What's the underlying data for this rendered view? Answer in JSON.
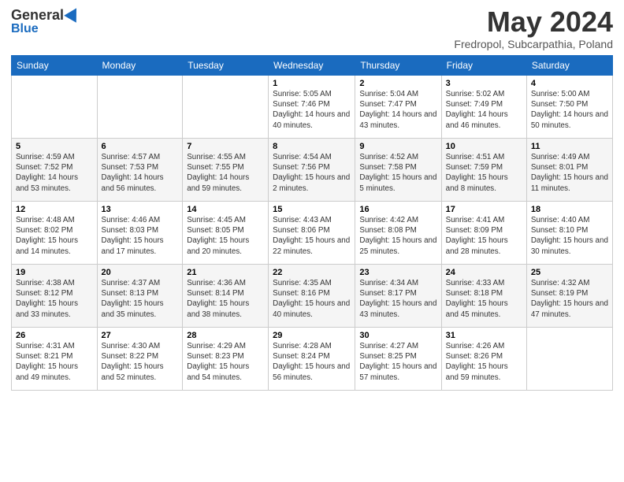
{
  "logo": {
    "general": "General",
    "blue": "Blue"
  },
  "header": {
    "month": "May 2024",
    "location": "Fredropol, Subcarpathia, Poland"
  },
  "weekdays": [
    "Sunday",
    "Monday",
    "Tuesday",
    "Wednesday",
    "Thursday",
    "Friday",
    "Saturday"
  ],
  "weeks": [
    [
      null,
      null,
      null,
      {
        "day": 1,
        "sunrise": "5:05 AM",
        "sunset": "7:46 PM",
        "daylight": "14 hours and 40 minutes."
      },
      {
        "day": 2,
        "sunrise": "5:04 AM",
        "sunset": "7:47 PM",
        "daylight": "14 hours and 43 minutes."
      },
      {
        "day": 3,
        "sunrise": "5:02 AM",
        "sunset": "7:49 PM",
        "daylight": "14 hours and 46 minutes."
      },
      {
        "day": 4,
        "sunrise": "5:00 AM",
        "sunset": "7:50 PM",
        "daylight": "14 hours and 50 minutes."
      }
    ],
    [
      {
        "day": 5,
        "sunrise": "4:59 AM",
        "sunset": "7:52 PM",
        "daylight": "14 hours and 53 minutes."
      },
      {
        "day": 6,
        "sunrise": "4:57 AM",
        "sunset": "7:53 PM",
        "daylight": "14 hours and 56 minutes."
      },
      {
        "day": 7,
        "sunrise": "4:55 AM",
        "sunset": "7:55 PM",
        "daylight": "14 hours and 59 minutes."
      },
      {
        "day": 8,
        "sunrise": "4:54 AM",
        "sunset": "7:56 PM",
        "daylight": "15 hours and 2 minutes."
      },
      {
        "day": 9,
        "sunrise": "4:52 AM",
        "sunset": "7:58 PM",
        "daylight": "15 hours and 5 minutes."
      },
      {
        "day": 10,
        "sunrise": "4:51 AM",
        "sunset": "7:59 PM",
        "daylight": "15 hours and 8 minutes."
      },
      {
        "day": 11,
        "sunrise": "4:49 AM",
        "sunset": "8:01 PM",
        "daylight": "15 hours and 11 minutes."
      }
    ],
    [
      {
        "day": 12,
        "sunrise": "4:48 AM",
        "sunset": "8:02 PM",
        "daylight": "15 hours and 14 minutes."
      },
      {
        "day": 13,
        "sunrise": "4:46 AM",
        "sunset": "8:03 PM",
        "daylight": "15 hours and 17 minutes."
      },
      {
        "day": 14,
        "sunrise": "4:45 AM",
        "sunset": "8:05 PM",
        "daylight": "15 hours and 20 minutes."
      },
      {
        "day": 15,
        "sunrise": "4:43 AM",
        "sunset": "8:06 PM",
        "daylight": "15 hours and 22 minutes."
      },
      {
        "day": 16,
        "sunrise": "4:42 AM",
        "sunset": "8:08 PM",
        "daylight": "15 hours and 25 minutes."
      },
      {
        "day": 17,
        "sunrise": "4:41 AM",
        "sunset": "8:09 PM",
        "daylight": "15 hours and 28 minutes."
      },
      {
        "day": 18,
        "sunrise": "4:40 AM",
        "sunset": "8:10 PM",
        "daylight": "15 hours and 30 minutes."
      }
    ],
    [
      {
        "day": 19,
        "sunrise": "4:38 AM",
        "sunset": "8:12 PM",
        "daylight": "15 hours and 33 minutes."
      },
      {
        "day": 20,
        "sunrise": "4:37 AM",
        "sunset": "8:13 PM",
        "daylight": "15 hours and 35 minutes."
      },
      {
        "day": 21,
        "sunrise": "4:36 AM",
        "sunset": "8:14 PM",
        "daylight": "15 hours and 38 minutes."
      },
      {
        "day": 22,
        "sunrise": "4:35 AM",
        "sunset": "8:16 PM",
        "daylight": "15 hours and 40 minutes."
      },
      {
        "day": 23,
        "sunrise": "4:34 AM",
        "sunset": "8:17 PM",
        "daylight": "15 hours and 43 minutes."
      },
      {
        "day": 24,
        "sunrise": "4:33 AM",
        "sunset": "8:18 PM",
        "daylight": "15 hours and 45 minutes."
      },
      {
        "day": 25,
        "sunrise": "4:32 AM",
        "sunset": "8:19 PM",
        "daylight": "15 hours and 47 minutes."
      }
    ],
    [
      {
        "day": 26,
        "sunrise": "4:31 AM",
        "sunset": "8:21 PM",
        "daylight": "15 hours and 49 minutes."
      },
      {
        "day": 27,
        "sunrise": "4:30 AM",
        "sunset": "8:22 PM",
        "daylight": "15 hours and 52 minutes."
      },
      {
        "day": 28,
        "sunrise": "4:29 AM",
        "sunset": "8:23 PM",
        "daylight": "15 hours and 54 minutes."
      },
      {
        "day": 29,
        "sunrise": "4:28 AM",
        "sunset": "8:24 PM",
        "daylight": "15 hours and 56 minutes."
      },
      {
        "day": 30,
        "sunrise": "4:27 AM",
        "sunset": "8:25 PM",
        "daylight": "15 hours and 57 minutes."
      },
      {
        "day": 31,
        "sunrise": "4:26 AM",
        "sunset": "8:26 PM",
        "daylight": "15 hours and 59 minutes."
      },
      null
    ]
  ]
}
